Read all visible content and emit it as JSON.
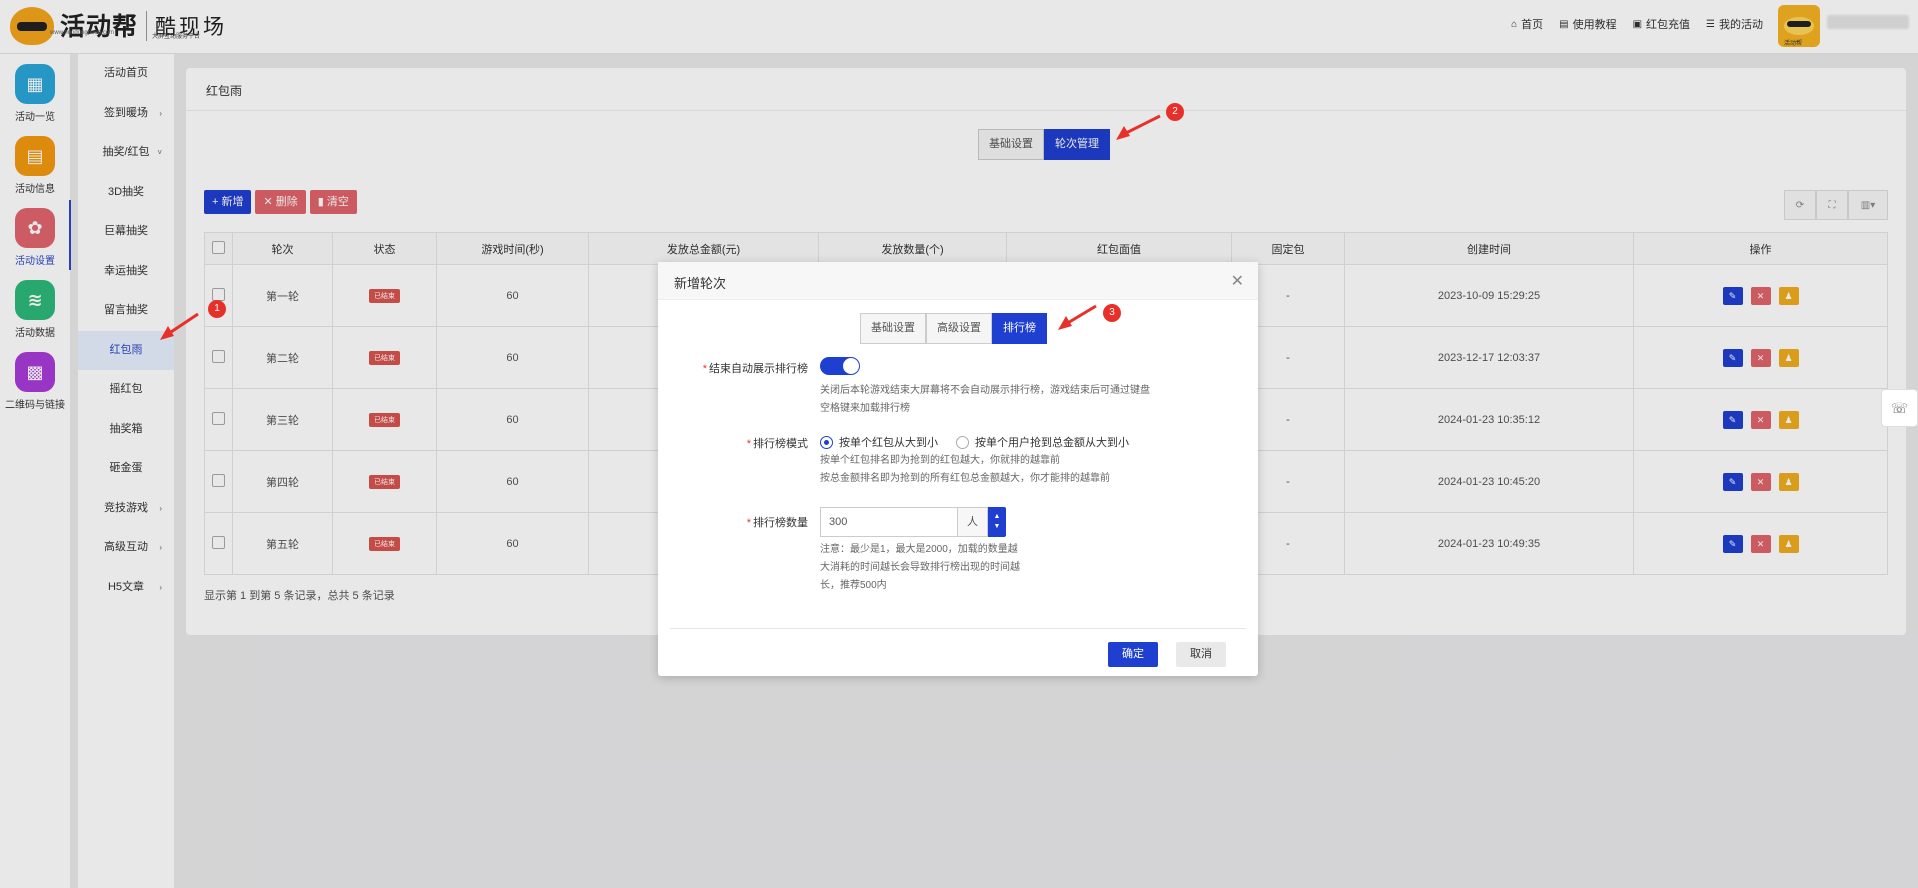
{
  "header": {
    "logo_text": "活动帮",
    "logo_sub": "www.huodongbaoo.com",
    "brand": "酷现场",
    "brand_sub": "大屏互动服务平台",
    "nav": [
      {
        "icon": "home-icon",
        "glyph": "⌂",
        "label": "首页"
      },
      {
        "icon": "book-icon",
        "glyph": "▤",
        "label": "使用教程"
      },
      {
        "icon": "wallet-icon",
        "glyph": "▣",
        "label": "红包充值"
      },
      {
        "icon": "list-icon",
        "glyph": "☰",
        "label": "我的活动"
      }
    ],
    "avatar_caption": "活动帮"
  },
  "rail": [
    {
      "label": "活动一览",
      "color": "#2aa7d8",
      "glyph": "▦"
    },
    {
      "label": "活动信息",
      "color": "#f2990f",
      "glyph": "▤"
    },
    {
      "label": "活动设置",
      "color": "#e2646e",
      "glyph": "✿",
      "active": true
    },
    {
      "label": "活动数据",
      "color": "#2db97a",
      "glyph": "≋"
    },
    {
      "label": "二维码与链接",
      "color": "#a93bd8",
      "glyph": "▩"
    }
  ],
  "submenu": [
    {
      "label": "活动首页",
      "arrow": ""
    },
    {
      "label": "签到暖场",
      "arrow": "›"
    },
    {
      "label": "抽奖/红包",
      "arrow": "˅"
    },
    {
      "label": "3D抽奖",
      "arrow": ""
    },
    {
      "label": "巨幕抽奖",
      "arrow": ""
    },
    {
      "label": "幸运抽奖",
      "arrow": ""
    },
    {
      "label": "留言抽奖",
      "arrow": ""
    },
    {
      "label": "红包雨",
      "arrow": "",
      "active": true
    },
    {
      "label": "摇红包",
      "arrow": ""
    },
    {
      "label": "抽奖箱",
      "arrow": ""
    },
    {
      "label": "砸金蛋",
      "arrow": ""
    },
    {
      "label": "竞技游戏",
      "arrow": "›"
    },
    {
      "label": "高级互动",
      "arrow": "›"
    },
    {
      "label": "H5文章",
      "arrow": "›"
    }
  ],
  "page": {
    "title": "红包雨",
    "tabs": [
      "基础设置",
      "轮次管理"
    ],
    "active_tab": 1,
    "toolbar": {
      "add": "+ 新增",
      "delete": "✕ 删除",
      "clear": "▮ 清空"
    },
    "columns": [
      "轮次",
      "状态",
      "游戏时间(秒)",
      "发放总金额(元)",
      "发放数量(个)",
      "红包面值",
      "固定包",
      "创建时间",
      "操作"
    ],
    "rows": [
      {
        "round": "第一轮",
        "status": "已结束",
        "time": "60",
        "fixed": "-",
        "created": "2023-10-09 15:29:25"
      },
      {
        "round": "第二轮",
        "status": "已结束",
        "time": "60",
        "fixed": "-",
        "created": "2023-12-17 12:03:37"
      },
      {
        "round": "第三轮",
        "status": "已结束",
        "time": "60",
        "fixed": "-",
        "created": "2024-01-23 10:35:12"
      },
      {
        "round": "第四轮",
        "status": "已结束",
        "time": "60",
        "fixed": "-",
        "created": "2024-01-23 10:45:20"
      },
      {
        "round": "第五轮",
        "status": "已结束",
        "time": "60",
        "fixed": "-",
        "created": "2024-01-23 10:49:35"
      }
    ],
    "page_info": "显示第 1 到第 5 条记录，总共 5 条记录"
  },
  "modal": {
    "title": "新增轮次",
    "tabs": [
      "基础设置",
      "高级设置",
      "排行榜"
    ],
    "active_tab": 2,
    "field1_label": "结束自动展示排行榜",
    "field1_help1": "关闭后本轮游戏结束大屏幕将不会自动展示排行榜，游戏结束后可通过键盘",
    "field1_help2": "空格键来加载排行榜",
    "field1_on": true,
    "field2_label": "排行榜模式",
    "field2_opt1": "按单个红包从大到小",
    "field2_opt2": "按单个用户抢到总金额从大到小",
    "field2_help1": "按单个红包排名即为抢到的红包越大，你就排的越靠前",
    "field2_help2": "按总金额排名即为抢到的所有红包总金额越大，你才能排的越靠前",
    "field3_label": "排行榜数量",
    "field3_value": "300",
    "field3_unit": "人",
    "field3_help1": "注意：最少是1，最大是2000，加载的数量越",
    "field3_help2": "大消耗的时间越长会导致排行榜出现的时间越",
    "field3_help3": "长，推荐500内",
    "ok": "确定",
    "cancel": "取消"
  },
  "annotations": [
    "1",
    "2",
    "3"
  ],
  "colors": {
    "primary": "#1f3fd1",
    "danger": "#e0646a",
    "warning": "#f0ad1e",
    "annotation": "#e8302a"
  }
}
